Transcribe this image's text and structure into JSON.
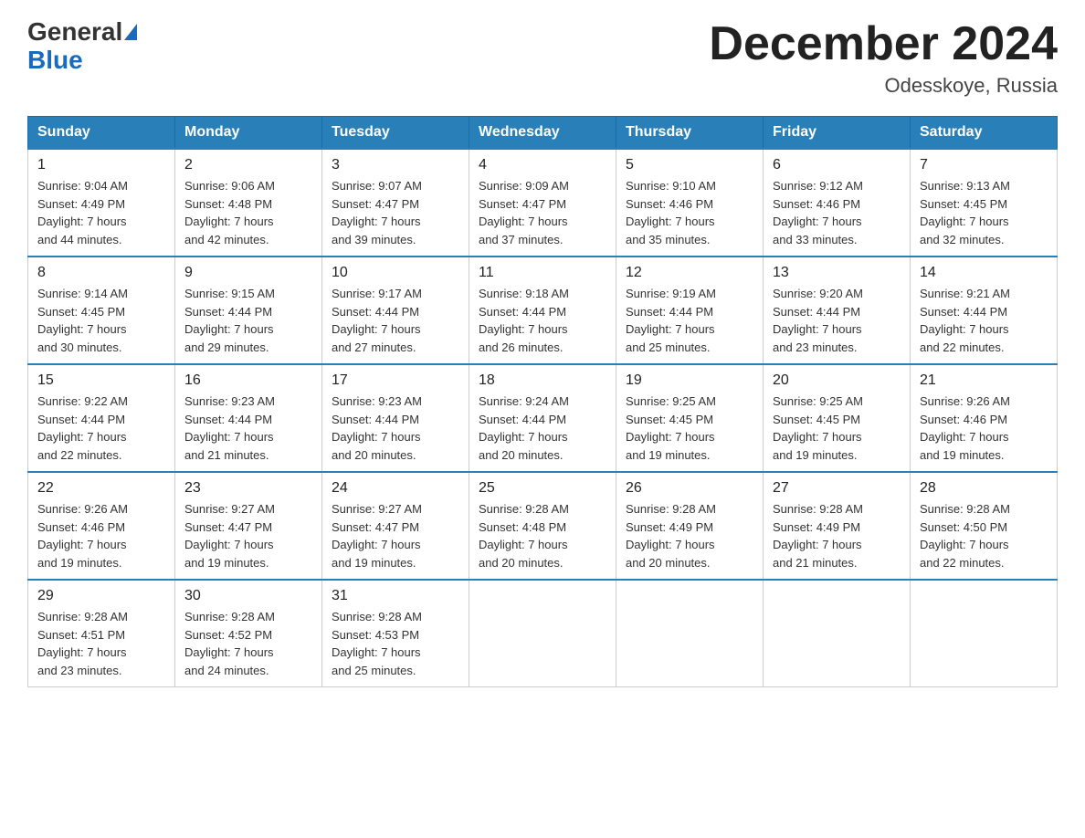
{
  "header": {
    "logo_general": "General",
    "logo_blue": "Blue",
    "title": "December 2024",
    "subtitle": "Odesskoye, Russia"
  },
  "days_of_week": [
    "Sunday",
    "Monday",
    "Tuesday",
    "Wednesday",
    "Thursday",
    "Friday",
    "Saturday"
  ],
  "weeks": [
    [
      {
        "day": "1",
        "sunrise": "9:04 AM",
        "sunset": "4:49 PM",
        "daylight": "7 hours and 44 minutes."
      },
      {
        "day": "2",
        "sunrise": "9:06 AM",
        "sunset": "4:48 PM",
        "daylight": "7 hours and 42 minutes."
      },
      {
        "day": "3",
        "sunrise": "9:07 AM",
        "sunset": "4:47 PM",
        "daylight": "7 hours and 39 minutes."
      },
      {
        "day": "4",
        "sunrise": "9:09 AM",
        "sunset": "4:47 PM",
        "daylight": "7 hours and 37 minutes."
      },
      {
        "day": "5",
        "sunrise": "9:10 AM",
        "sunset": "4:46 PM",
        "daylight": "7 hours and 35 minutes."
      },
      {
        "day": "6",
        "sunrise": "9:12 AM",
        "sunset": "4:46 PM",
        "daylight": "7 hours and 33 minutes."
      },
      {
        "day": "7",
        "sunrise": "9:13 AM",
        "sunset": "4:45 PM",
        "daylight": "7 hours and 32 minutes."
      }
    ],
    [
      {
        "day": "8",
        "sunrise": "9:14 AM",
        "sunset": "4:45 PM",
        "daylight": "7 hours and 30 minutes."
      },
      {
        "day": "9",
        "sunrise": "9:15 AM",
        "sunset": "4:44 PM",
        "daylight": "7 hours and 29 minutes."
      },
      {
        "day": "10",
        "sunrise": "9:17 AM",
        "sunset": "4:44 PM",
        "daylight": "7 hours and 27 minutes."
      },
      {
        "day": "11",
        "sunrise": "9:18 AM",
        "sunset": "4:44 PM",
        "daylight": "7 hours and 26 minutes."
      },
      {
        "day": "12",
        "sunrise": "9:19 AM",
        "sunset": "4:44 PM",
        "daylight": "7 hours and 25 minutes."
      },
      {
        "day": "13",
        "sunrise": "9:20 AM",
        "sunset": "4:44 PM",
        "daylight": "7 hours and 23 minutes."
      },
      {
        "day": "14",
        "sunrise": "9:21 AM",
        "sunset": "4:44 PM",
        "daylight": "7 hours and 22 minutes."
      }
    ],
    [
      {
        "day": "15",
        "sunrise": "9:22 AM",
        "sunset": "4:44 PM",
        "daylight": "7 hours and 22 minutes."
      },
      {
        "day": "16",
        "sunrise": "9:23 AM",
        "sunset": "4:44 PM",
        "daylight": "7 hours and 21 minutes."
      },
      {
        "day": "17",
        "sunrise": "9:23 AM",
        "sunset": "4:44 PM",
        "daylight": "7 hours and 20 minutes."
      },
      {
        "day": "18",
        "sunrise": "9:24 AM",
        "sunset": "4:44 PM",
        "daylight": "7 hours and 20 minutes."
      },
      {
        "day": "19",
        "sunrise": "9:25 AM",
        "sunset": "4:45 PM",
        "daylight": "7 hours and 19 minutes."
      },
      {
        "day": "20",
        "sunrise": "9:25 AM",
        "sunset": "4:45 PM",
        "daylight": "7 hours and 19 minutes."
      },
      {
        "day": "21",
        "sunrise": "9:26 AM",
        "sunset": "4:46 PM",
        "daylight": "7 hours and 19 minutes."
      }
    ],
    [
      {
        "day": "22",
        "sunrise": "9:26 AM",
        "sunset": "4:46 PM",
        "daylight": "7 hours and 19 minutes."
      },
      {
        "day": "23",
        "sunrise": "9:27 AM",
        "sunset": "4:47 PM",
        "daylight": "7 hours and 19 minutes."
      },
      {
        "day": "24",
        "sunrise": "9:27 AM",
        "sunset": "4:47 PM",
        "daylight": "7 hours and 19 minutes."
      },
      {
        "day": "25",
        "sunrise": "9:28 AM",
        "sunset": "4:48 PM",
        "daylight": "7 hours and 20 minutes."
      },
      {
        "day": "26",
        "sunrise": "9:28 AM",
        "sunset": "4:49 PM",
        "daylight": "7 hours and 20 minutes."
      },
      {
        "day": "27",
        "sunrise": "9:28 AM",
        "sunset": "4:49 PM",
        "daylight": "7 hours and 21 minutes."
      },
      {
        "day": "28",
        "sunrise": "9:28 AM",
        "sunset": "4:50 PM",
        "daylight": "7 hours and 22 minutes."
      }
    ],
    [
      {
        "day": "29",
        "sunrise": "9:28 AM",
        "sunset": "4:51 PM",
        "daylight": "7 hours and 23 minutes."
      },
      {
        "day": "30",
        "sunrise": "9:28 AM",
        "sunset": "4:52 PM",
        "daylight": "7 hours and 24 minutes."
      },
      {
        "day": "31",
        "sunrise": "9:28 AM",
        "sunset": "4:53 PM",
        "daylight": "7 hours and 25 minutes."
      },
      null,
      null,
      null,
      null
    ]
  ],
  "labels": {
    "sunrise": "Sunrise:",
    "sunset": "Sunset:",
    "daylight": "Daylight:"
  }
}
